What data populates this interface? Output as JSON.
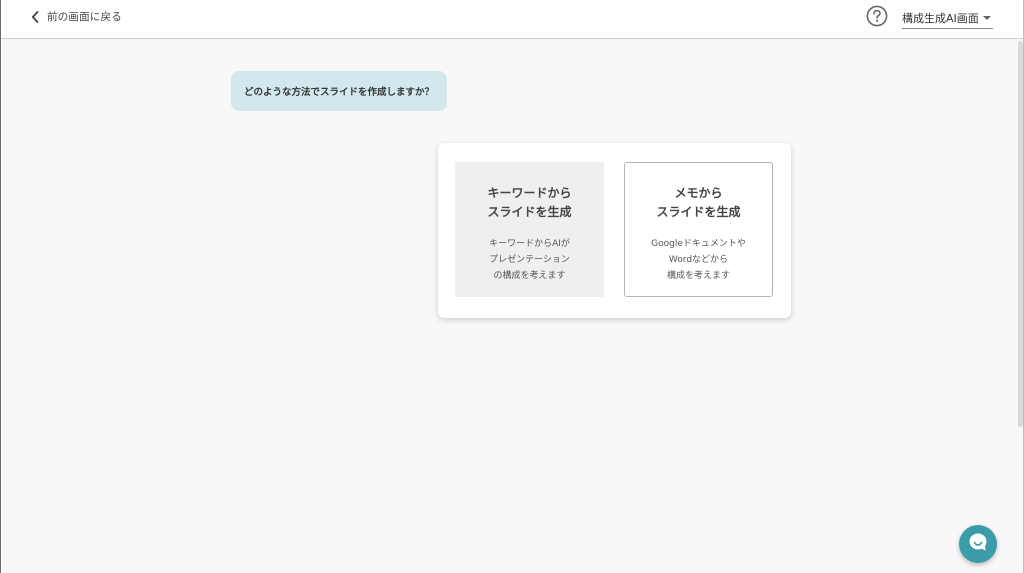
{
  "header": {
    "back_label": "前の画面に戻る",
    "help_icon": "question-circle-icon",
    "mode_select": {
      "selected": "構成生成AI画面"
    }
  },
  "prompt": {
    "question": "どのような方法でスライドを作成しますか？"
  },
  "options": [
    {
      "title_line1": "キーワードから",
      "title_line2": "スライドを生成",
      "desc_line1": "キーワードからAIが",
      "desc_line2": "プレゼンテーション",
      "desc_line3": "の構成を考えます"
    },
    {
      "title_line1": "メモから",
      "title_line2": "スライドを生成",
      "desc_line1": "Googleドキュメントや",
      "desc_line2": "Wordなどから",
      "desc_line3": "構成を考えます"
    }
  ],
  "chat_widget": {
    "icon": "chat-bubble-icon"
  },
  "colors": {
    "accent": "#3b9ca9",
    "bubble": "#d3e8ec",
    "background": "#f8f8f8"
  }
}
